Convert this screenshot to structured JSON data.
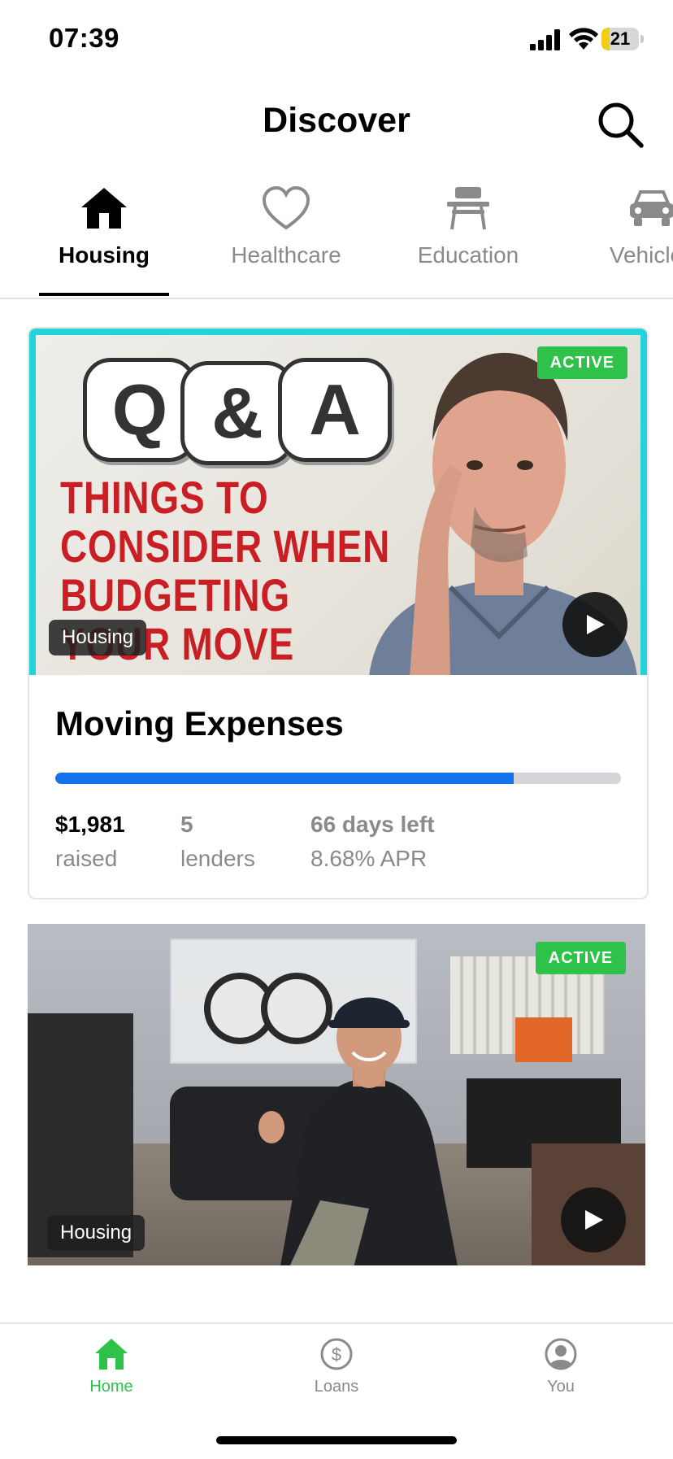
{
  "status_bar": {
    "time": "07:39",
    "battery_level": "21",
    "icons": [
      "cellular-signal-icon",
      "wifi-icon",
      "battery-icon"
    ]
  },
  "header": {
    "title": "Discover",
    "search_icon": "search-icon"
  },
  "tabs": [
    {
      "label": "Housing",
      "icon": "house-icon",
      "active": true
    },
    {
      "label": "Healthcare",
      "icon": "heart-icon",
      "active": false
    },
    {
      "label": "Education",
      "icon": "school-desk-icon",
      "active": false
    },
    {
      "label": "Vehicles",
      "icon": "car-icon",
      "active": false
    }
  ],
  "cards": [
    {
      "status": "ACTIVE",
      "category": "Housing",
      "thumbnail_text": {
        "qa": [
          "Q",
          "&",
          "A"
        ],
        "headline": "THINGS TO\nCONSIDER WHEN\nBUDGETING\nYOUR MOVE"
      },
      "title": "Moving Expenses",
      "progress_fraction": 0.81,
      "raised_value": "$1,981",
      "raised_label": "raised",
      "lenders_value": "5",
      "lenders_label": "lenders",
      "days_left": "66 days left",
      "apr": "8.68% APR"
    },
    {
      "status": "ACTIVE",
      "category": "Housing"
    }
  ],
  "bottom_nav": [
    {
      "label": "Home",
      "icon": "home-icon",
      "active": true
    },
    {
      "label": "Loans",
      "icon": "dollar-circle-icon",
      "active": false
    },
    {
      "label": "You",
      "icon": "user-circle-icon",
      "active": false
    }
  ],
  "colors": {
    "accent_green": "#2ec24b",
    "progress_blue": "#1273ea",
    "thumbnail_border": "#22d4da",
    "headline_red": "#c91e24"
  }
}
